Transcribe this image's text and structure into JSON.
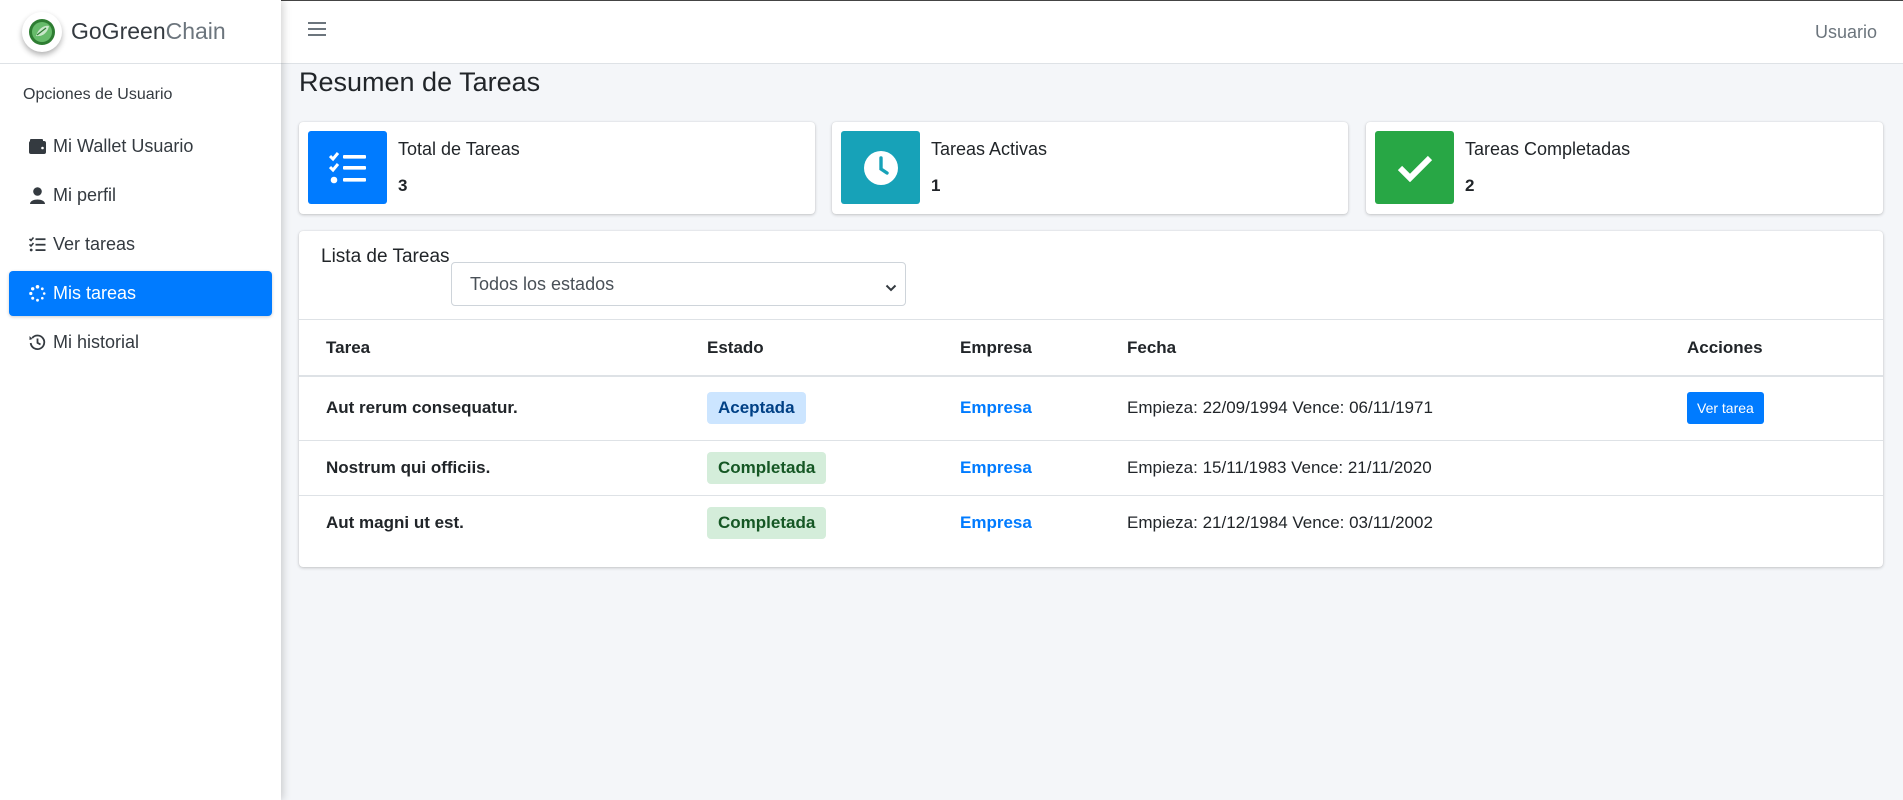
{
  "brand": {
    "name_bold": "GoGreen",
    "name_light": "Chain"
  },
  "sidebar": {
    "header": "Opciones de Usuario",
    "items": [
      {
        "label": "Mi Wallet Usuario",
        "icon": "wallet-icon",
        "active": false
      },
      {
        "label": "Mi perfil",
        "icon": "user-icon",
        "active": false
      },
      {
        "label": "Ver tareas",
        "icon": "tasks-list-icon",
        "active": false
      },
      {
        "label": "Mis tareas",
        "icon": "spinner-icon",
        "active": true
      },
      {
        "label": "Mi historial",
        "icon": "history-icon",
        "active": false
      }
    ]
  },
  "topbar": {
    "user_label": "Usuario"
  },
  "main": {
    "title": "Resumen de Tareas",
    "stats": [
      {
        "label": "Total de Tareas",
        "value": "3",
        "icon": "tasks-icon",
        "color": "#007bff"
      },
      {
        "label": "Tareas Activas",
        "value": "1",
        "icon": "clock-icon",
        "color": "#17a2b8"
      },
      {
        "label": "Tareas Completadas",
        "value": "2",
        "icon": "check-icon",
        "color": "#28a745"
      }
    ],
    "list": {
      "title": "Lista de Tareas",
      "filter_value": "Todos los estados",
      "columns": [
        "Tarea",
        "Estado",
        "Empresa",
        "Fecha",
        "Acciones"
      ],
      "rows": [
        {
          "task": "Aut rerum consequatur.",
          "status": "Aceptada",
          "company": "Empresa",
          "date": "Empieza: 22/09/1994 Vence: 06/11/1971",
          "action": "Ver tarea"
        },
        {
          "task": "Nostrum qui officiis.",
          "status": "Completada",
          "company": "Empresa",
          "date": "Empieza: 15/11/1983 Vence: 21/11/2020",
          "action": ""
        },
        {
          "task": "Aut magni ut est.",
          "status": "Completada",
          "company": "Empresa",
          "date": "Empieza: 21/12/1984 Vence: 03/11/2002",
          "action": ""
        }
      ]
    }
  },
  "colors": {
    "primary": "#007bff",
    "info": "#17a2b8",
    "success": "#28a745"
  }
}
